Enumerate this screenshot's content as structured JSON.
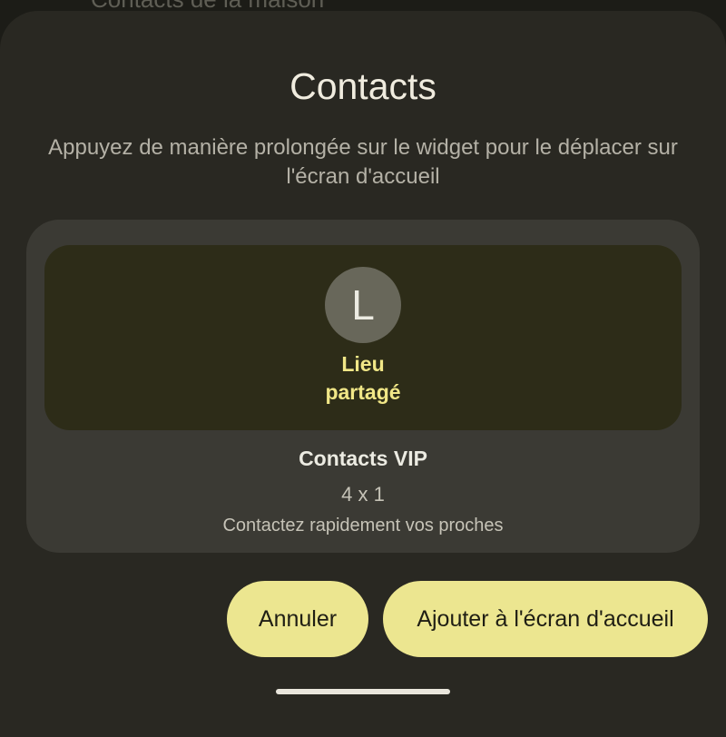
{
  "background": {
    "partial_text": "Contacts de la maison"
  },
  "sheet": {
    "title": "Contacts",
    "subtitle": "Appuyez de manière prolongée sur le widget pour le déplacer sur l'écran d'accueil"
  },
  "widget_preview": {
    "avatar_letter": "L",
    "contact_name": "Lieu partagé",
    "widget_name": "Contacts VIP",
    "size": "4 x 1",
    "description": "Contactez rapidement vos proches"
  },
  "actions": {
    "cancel_label": "Annuler",
    "add_label": "Ajouter à l'écran d'accueil"
  },
  "colors": {
    "accent": "#ece690",
    "name_text": "#f1e787",
    "sheet_bg": "#292822",
    "card_bg": "#3b3a34",
    "widget_bg": "#2d2c18"
  }
}
